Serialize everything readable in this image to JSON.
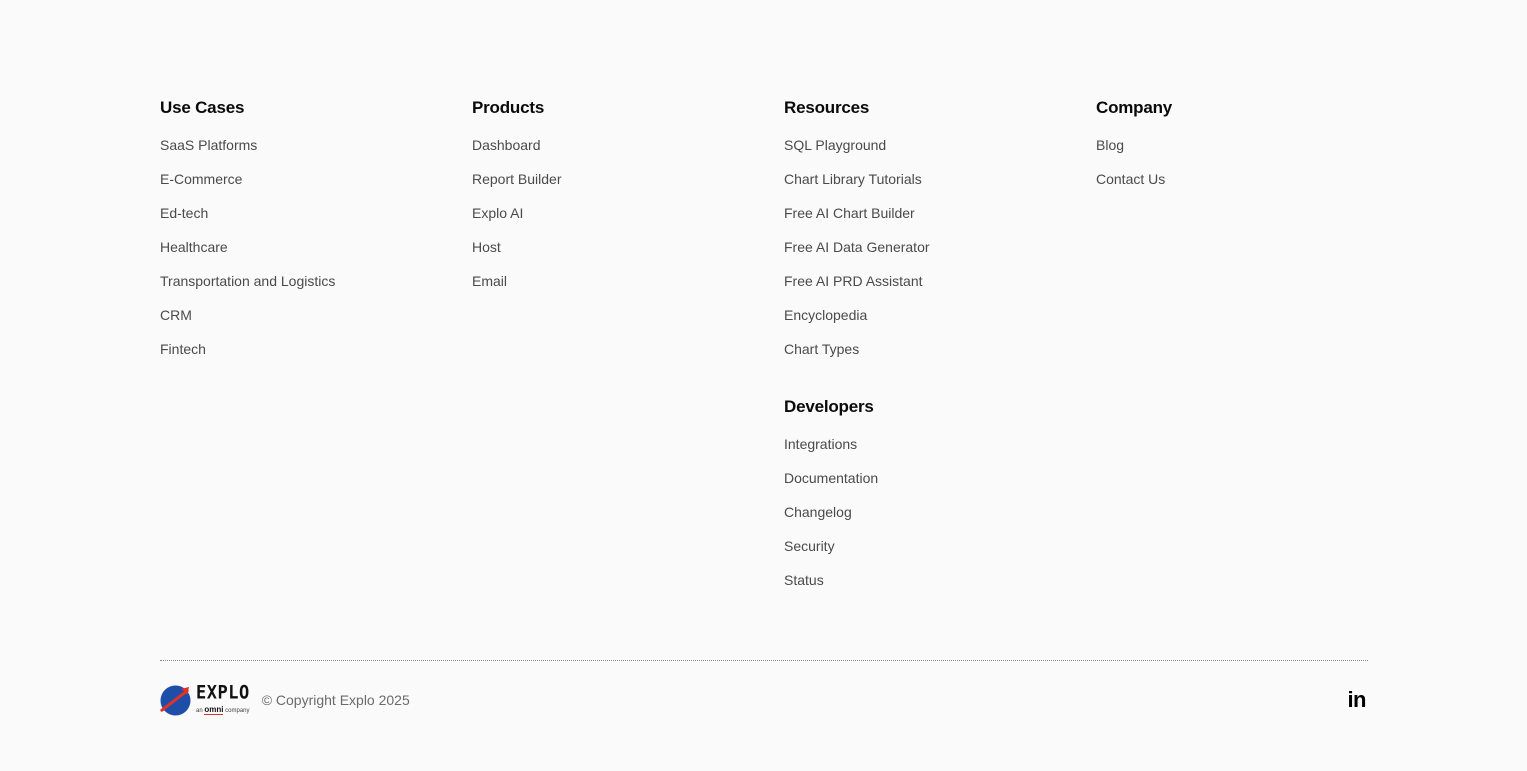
{
  "columns": {
    "use_cases": {
      "title": "Use Cases",
      "items": [
        "SaaS Platforms",
        "E-Commerce",
        "Ed-tech",
        "Healthcare",
        "Transportation and Logistics",
        "CRM",
        "Fintech"
      ]
    },
    "products": {
      "title": "Products",
      "items": [
        "Dashboard",
        "Report Builder",
        "Explo AI",
        "Host",
        "Email"
      ]
    },
    "resources": {
      "title": "Resources",
      "items": [
        "SQL Playground",
        "Chart Library Tutorials",
        "Free AI Chart Builder",
        "Free AI Data Generator",
        "Free AI PRD Assistant",
        "Encyclopedia",
        "Chart Types"
      ]
    },
    "developers": {
      "title": "Developers",
      "items": [
        "Integrations",
        "Documentation",
        "Changelog",
        "Security",
        "Status"
      ]
    },
    "company": {
      "title": "Company",
      "items": [
        "Blog",
        "Contact Us"
      ]
    }
  },
  "footer": {
    "logo_wordmark": "EXPLO",
    "logo_byline_prefix": "an",
    "logo_byline_brand": "omni",
    "logo_byline_suffix": "company",
    "copyright": "© Copyright Explo 2025",
    "social_icon": "linkedin-icon",
    "social_glyph": "in"
  },
  "colors": {
    "background": "#fafafa",
    "heading": "#0a0a0a",
    "link": "#4a4a4a",
    "logo_blue": "#1f4ea8",
    "logo_accent": "#e0312b"
  }
}
